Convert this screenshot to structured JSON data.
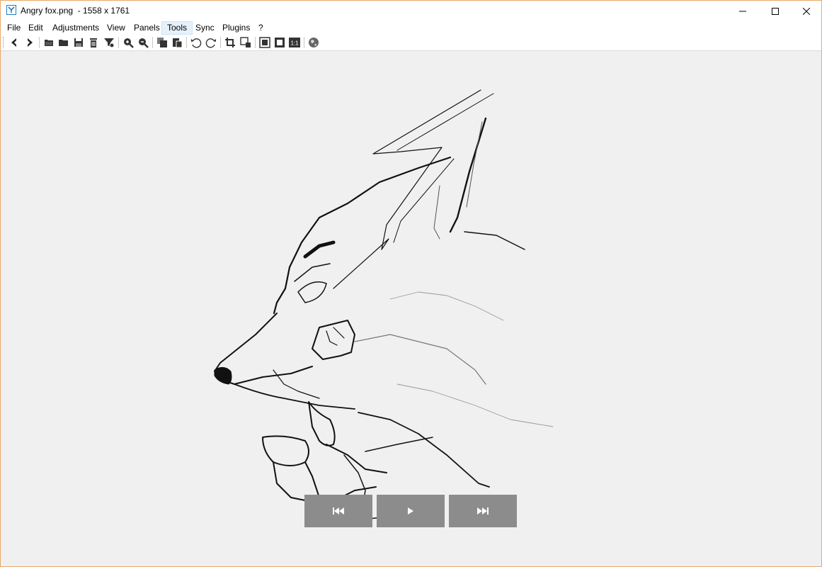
{
  "window": {
    "title": "Angry fox.png  - 1558 x 1761",
    "app_icon": "imageglass-logo-icon"
  },
  "window_controls": [
    "minimize-icon",
    "maximize-icon",
    "close-icon"
  ],
  "menu": {
    "items": [
      {
        "label": "File"
      },
      {
        "label": "Edit"
      },
      {
        "label": "Adjustments"
      },
      {
        "label": "View"
      },
      {
        "label": "Panels"
      },
      {
        "label": "Tools"
      },
      {
        "label": "Sync"
      },
      {
        "label": "Plugins"
      },
      {
        "label": "?"
      }
    ],
    "active": "Tools"
  },
  "toolbar": {
    "icons": [
      "back-icon",
      "forward-icon",
      "open-file-icon",
      "open-folder-icon",
      "save-icon",
      "delete-icon",
      "filter-icon",
      "zoom-in-icon",
      "zoom-out-icon",
      "copy-icon",
      "paste-icon",
      "rotate-left-icon",
      "rotate-right-icon",
      "crop-icon",
      "resize-icon",
      "fit-window-icon",
      "fullscreen-icon",
      "actual-size-icon",
      "web-icon"
    ],
    "actual_size_label": "1:1"
  },
  "image": {
    "subject": "angry-fox-line-drawing"
  },
  "slideshow_controls": [
    "previous-icon",
    "play-icon",
    "next-icon"
  ],
  "colors": {
    "window_border": "#e8a86a",
    "canvas_bg": "#f0f0f0",
    "menu_active_bg": "#e5f1fb",
    "nav_button_bg": "#8c8c8c"
  }
}
